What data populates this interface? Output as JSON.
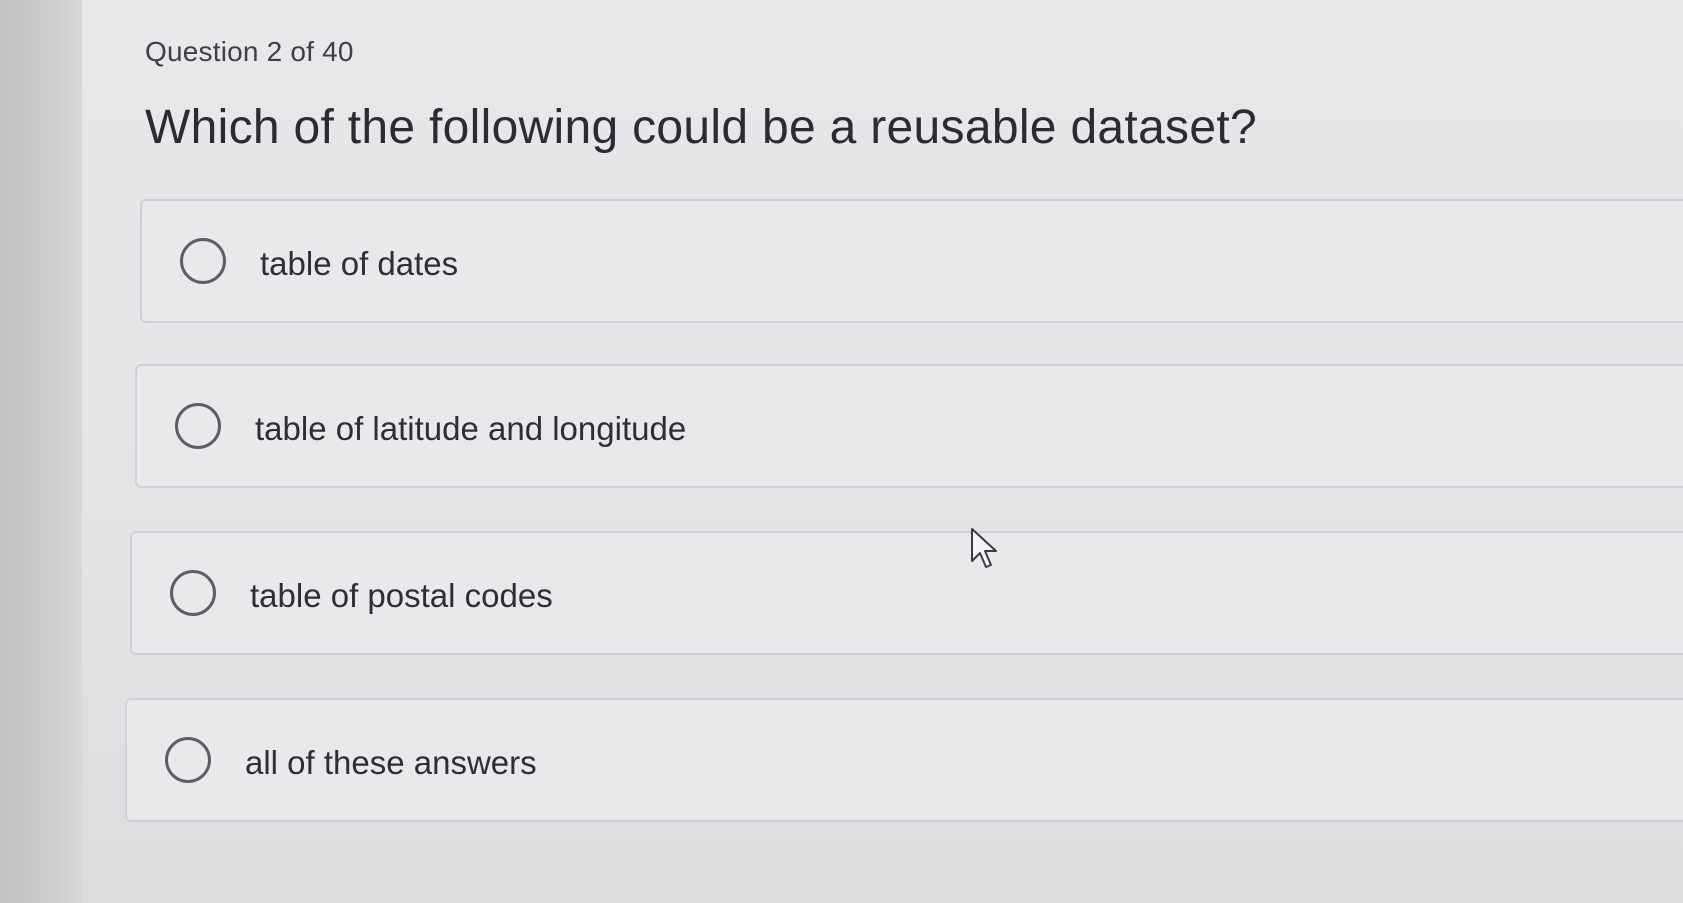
{
  "question": {
    "counter": "Question 2 of 40",
    "prompt": "Which of the following could be a reusable dataset?"
  },
  "choices": [
    {
      "label": "table of dates",
      "selected": false
    },
    {
      "label": "table of latitude and longitude",
      "selected": false
    },
    {
      "label": "table of postal codes",
      "selected": false
    },
    {
      "label": "all of these answers",
      "selected": false
    }
  ],
  "icons": {
    "radio": "radio-button-icon",
    "cursor": "mouse-pointer-icon"
  }
}
